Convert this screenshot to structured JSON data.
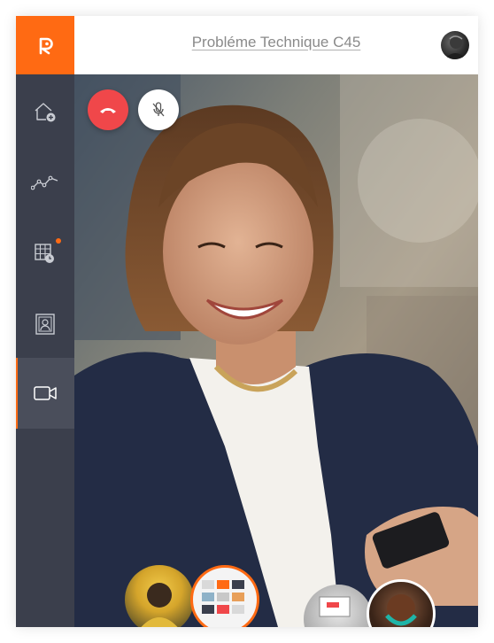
{
  "header": {
    "title": "Probléme Technique C45"
  },
  "sidebar": {
    "items": [
      {
        "name": "home-add",
        "icon": "home-plus-icon",
        "active": false
      },
      {
        "name": "analytics",
        "icon": "line-chart-icon",
        "active": false
      },
      {
        "name": "calendar",
        "icon": "calendar-icon",
        "active": false,
        "badge": true
      },
      {
        "name": "contacts",
        "icon": "contact-card-icon",
        "active": false
      },
      {
        "name": "video",
        "icon": "video-camera-icon",
        "active": true
      }
    ]
  },
  "call": {
    "hangup_icon": "hang-up-icon",
    "mute_icon": "microphone-muted-icon"
  },
  "participants": [
    {
      "name": "participant-hooded-person",
      "icon": "participant-thumbnail"
    },
    {
      "name": "participant-screen-share",
      "icon": "screen-share-thumbnail"
    },
    {
      "name": "participant-laptop",
      "icon": "participant-thumbnail"
    },
    {
      "name": "participant-headphones-woman",
      "icon": "participant-thumbnail"
    }
  ],
  "colors": {
    "accent": "#ff6a13",
    "sidebar": "#3b3f4c",
    "hangup": "#f0474a"
  }
}
